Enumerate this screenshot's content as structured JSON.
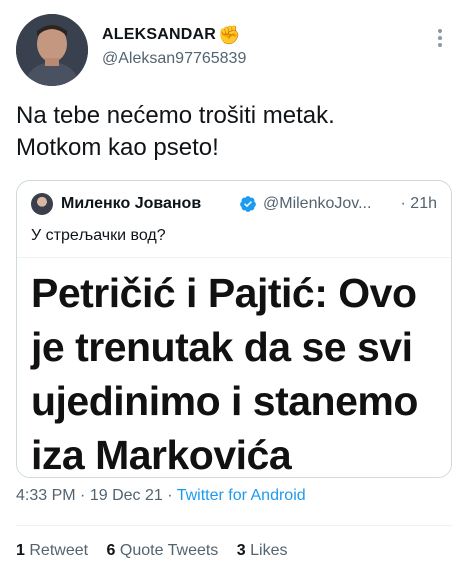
{
  "author": {
    "display_name": "ALEKSANDAR",
    "emoji": "✊",
    "handle": "@Aleksan97765839"
  },
  "tweet": {
    "text": "Na tebe nećemo trošiti metak.\nMotkom kao pseto!"
  },
  "quoted": {
    "display_name": "Миленко Јованов",
    "handle": "@MilenkoJov...",
    "separator": "·",
    "time": "21h",
    "text": "У стрељачки вод?",
    "image_headline": "Petričić i Pajtić: Ovo je trenutak da se svi ujedinimo i stanemo iza Markovića"
  },
  "meta": {
    "time": "4:33 PM",
    "sep1": "·",
    "date": "19 Dec 21",
    "sep2": "·",
    "source": "Twitter for Android"
  },
  "stats": {
    "retweets_count": "1",
    "retweets_label": "Retweet",
    "quotes_count": "6",
    "quotes_label": "Quote Tweets",
    "likes_count": "3",
    "likes_label": "Likes"
  },
  "colors": {
    "link": "#1d9bf0",
    "secondary_text": "#536471",
    "border": "#cfd9de"
  },
  "icons": [
    "more-icon",
    "verified-badge-icon"
  ]
}
